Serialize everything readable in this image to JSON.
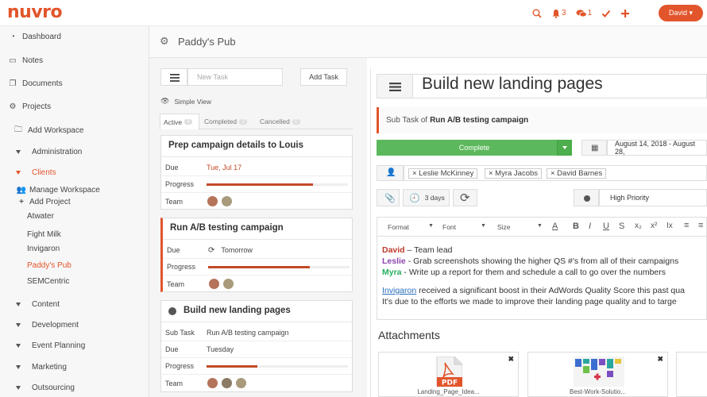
{
  "app": {
    "logo": "nuvro"
  },
  "topbar": {
    "notif_count": "3",
    "msg_count": "1",
    "user": "David ▾"
  },
  "sidebar": {
    "dashboard": "Dashboard",
    "notes": "Notes",
    "documents": "Documents",
    "projects": "Projects",
    "add_workspace": "Add Workspace",
    "administration": "Administration",
    "clients": "Clients",
    "manage_workspace": "Manage Workspace",
    "add_project": "Add Project",
    "client_items": [
      "Atwater",
      "Fight Milk",
      "Invigaron",
      "Paddy's Pub",
      "SEMCentric"
    ],
    "content": "Content",
    "development": "Development",
    "event_planning": "Event Planning",
    "marketing": "Marketing",
    "outsourcing": "Outsourcing"
  },
  "header": {
    "title": "Paddy's Pub"
  },
  "tasks": {
    "new_task_placeholder": "New Task",
    "add_task": "Add Task",
    "simple_view": "Simple View",
    "tabs": [
      {
        "label": "Active",
        "count": "4"
      },
      {
        "label": "Completed",
        "count": "3"
      },
      {
        "label": "Cancelled",
        "count": "0"
      }
    ],
    "labels": {
      "due": "Due",
      "progress": "Progress",
      "team": "Team",
      "subtask": "Sub Task"
    },
    "cards": [
      {
        "title": "Prep campaign details to Louis",
        "due": "Tue, Jul 17",
        "progress": 0.75
      },
      {
        "title": "Run A/B testing campaign",
        "due": "Tomorrow",
        "progress": 0.72
      },
      {
        "title": "Build new landing pages",
        "subtask": "Run A/B testing campaign",
        "due": "Tuesday",
        "progress": 0.36
      }
    ]
  },
  "detail": {
    "title": "Build new landing pages",
    "subtask_prefix": "Sub Task of ",
    "subtask_name": "Run A/B testing campaign",
    "complete": "Complete",
    "dates": "August 14, 2018 - August 28,",
    "tags": [
      "× Leslie McKinney",
      "× Myra Jacobs",
      "× David Barnes"
    ],
    "duration": "3 days",
    "priority": "High Priority",
    "editor_toolbar": {
      "format": "Format",
      "font": "Font",
      "size": "Size"
    },
    "notes": [
      {
        "name": "David",
        "text": " – Team lead",
        "color": "#c0392b"
      },
      {
        "name": "Leslie",
        "text": " - Grab screenshots showing the higher QS #'s from all of their campaigns",
        "color": "#8e44ad"
      },
      {
        "name": "Myra",
        "text": " - Write up a report for them and schedule a call to go over the numbers",
        "color": "#27ae60"
      }
    ],
    "para_link": "Invigaron",
    "para1": " received a significant boost in their AdWords Quality Score this past qua",
    "para2": "It's due to the efforts we made to improve their landing page quality and to targe",
    "attachments_title": "Attachments",
    "attachments": [
      "Landing_Page_Idea...",
      "Best-Work-Solutio..."
    ]
  },
  "colors": {
    "brand": "#e2552b",
    "complete": "#5cb85c",
    "progress": "#c14a26"
  }
}
